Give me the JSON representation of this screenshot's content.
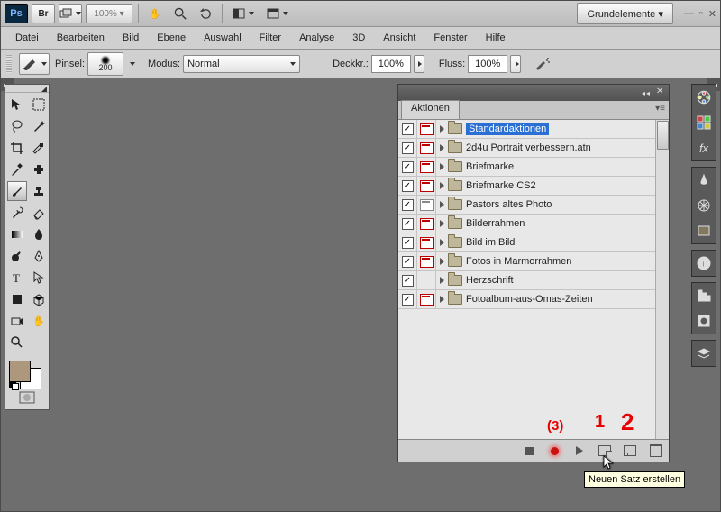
{
  "tabbar": {
    "zoom": "100% ▾",
    "workspace": "Grundelemente ▾"
  },
  "menu": [
    "Datei",
    "Bearbeiten",
    "Bild",
    "Ebene",
    "Auswahl",
    "Filter",
    "Analyse",
    "3D",
    "Ansicht",
    "Fenster",
    "Hilfe"
  ],
  "options": {
    "brush_label": "Pinsel:",
    "brush_size": "200",
    "mode_label": "Modus:",
    "mode_value": "Normal",
    "opacity_label": "Deckkr.:",
    "opacity_value": "100%",
    "flow_label": "Fluss:",
    "flow_value": "100%"
  },
  "actions_panel": {
    "tab": "Aktionen",
    "rows": [
      {
        "chk": true,
        "dlg": "red",
        "name": "Standardaktionen",
        "sel": true
      },
      {
        "chk": true,
        "dlg": "red",
        "name": "2d4u Portrait verbessern.atn"
      },
      {
        "chk": true,
        "dlg": "red",
        "name": "Briefmarke"
      },
      {
        "chk": true,
        "dlg": "red",
        "name": "Briefmarke CS2"
      },
      {
        "chk": true,
        "dlg": "grey",
        "name": "Pastors altes Photo"
      },
      {
        "chk": true,
        "dlg": "red",
        "name": "Bilderrahmen"
      },
      {
        "chk": true,
        "dlg": "red",
        "name": "Bild im Bild"
      },
      {
        "chk": true,
        "dlg": "red",
        "name": "Fotos in Marmorrahmen"
      },
      {
        "chk": true,
        "dlg": "blank",
        "name": "Herzschrift"
      },
      {
        "chk": true,
        "dlg": "red",
        "name": "Fotoalbum-aus-Omas-Zeiten"
      }
    ],
    "tooltip": "Neuen Satz erstellen"
  },
  "annotations": {
    "three": "(3)",
    "one": "1",
    "two": "2"
  }
}
